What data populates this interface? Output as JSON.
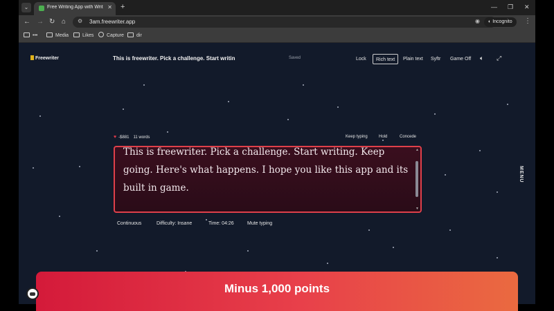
{
  "browser": {
    "tab_title": "Free Writing App with Writ",
    "url": "3am.freewriter.app",
    "incognito_label": "Incognito",
    "bookmarks": [
      "Media",
      "Likes",
      "Capture",
      "dir"
    ],
    "bookmark_overflow": "•••"
  },
  "app": {
    "logo": "Freewriter",
    "header_text": "This is freewriter. Pick a challenge. Start writin",
    "save_status": "Saved",
    "modes": [
      "Lock",
      "Rich text",
      "Plain text",
      "Syftr",
      "Game Off"
    ],
    "active_mode": "Rich text",
    "menu_label": "MENU"
  },
  "game": {
    "score": "-$881",
    "word_count": "11 words",
    "actions": [
      "Keep typing",
      "Hold",
      "Concede"
    ]
  },
  "editor": {
    "text": "This is freewriter. Pick a challenge. Start writing. Keep going. Here's what happens. I hope you like this app and its built in game."
  },
  "footer": {
    "mode": "Continuous",
    "difficulty": "Difficulty: Insane",
    "time": "Time: 04:26",
    "mute": "Mute typing"
  },
  "banner": {
    "text": "Minus 1,000 points"
  },
  "colors": {
    "accent_red": "#e0404a",
    "banner_start": "#d41a3a",
    "banner_end": "#ea6a40",
    "background": "#121a2a"
  }
}
